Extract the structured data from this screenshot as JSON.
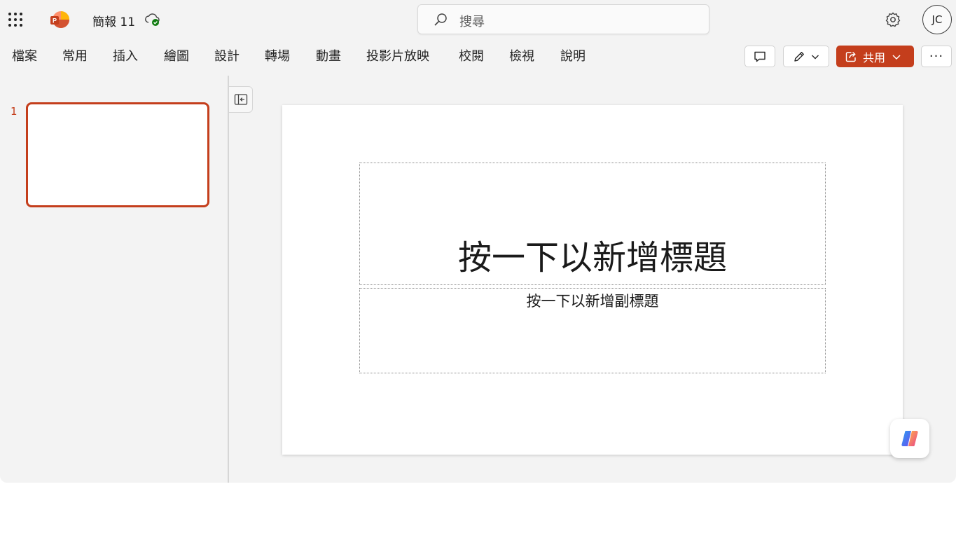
{
  "titlebar": {
    "doc_title": "簡報 11",
    "search_placeholder": "搜尋",
    "avatar_initials": "JC"
  },
  "ribbon": {
    "tabs": [
      "檔案",
      "常用",
      "插入",
      "繪圖",
      "設計",
      "轉場",
      "動畫",
      "投影片放映",
      "校閱",
      "檢視",
      "說明"
    ],
    "share_label": "共用",
    "more_label": "···"
  },
  "thumbnails": {
    "items": [
      {
        "number": "1"
      }
    ]
  },
  "slide": {
    "title_placeholder": "按一下以新增標題",
    "subtitle_placeholder": "按一下以新增副標題"
  },
  "colors": {
    "accent": "#c43e1c",
    "background": "#f3f3f3",
    "slide": "#ffffff"
  },
  "icons": [
    "app-launcher-icon",
    "powerpoint-logo-icon",
    "cloud-saved-icon",
    "search-icon",
    "gear-icon",
    "comment-icon",
    "pen-icon",
    "chevron-down-icon",
    "share-icon",
    "more-icon",
    "collapse-pane-icon",
    "copilot-icon"
  ]
}
